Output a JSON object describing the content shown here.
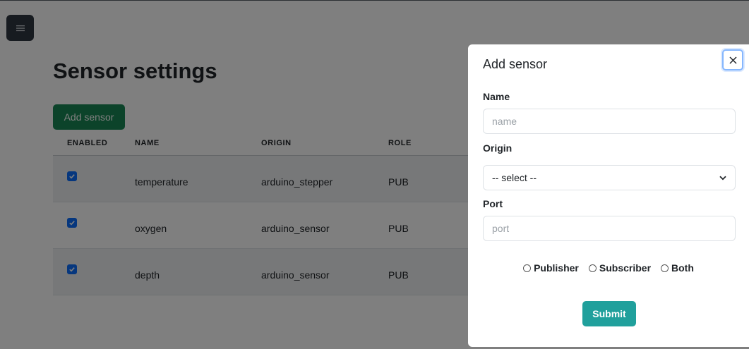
{
  "page": {
    "title": "Sensor settings",
    "add_button_label": "Add sensor"
  },
  "table": {
    "headers": [
      "ENABLED",
      "NAME",
      "ORIGIN",
      "ROLE"
    ],
    "rows": [
      {
        "enabled": true,
        "name": "temperature",
        "origin": "arduino_stepper",
        "role": "PUB"
      },
      {
        "enabled": true,
        "name": "oxygen",
        "origin": "arduino_sensor",
        "role": "PUB"
      },
      {
        "enabled": true,
        "name": "depth",
        "origin": "arduino_sensor",
        "role": "PUB"
      }
    ]
  },
  "offcanvas": {
    "title": "Add sensor",
    "close_label": "×",
    "name_label": "Name",
    "name_placeholder": "name",
    "origin_label": "Origin",
    "origin_selected": "-- select --",
    "port_label": "Port",
    "port_placeholder": "port",
    "roles": [
      "Publisher",
      "Subscriber",
      "Both"
    ],
    "submit_label": "Submit"
  },
  "icons": {
    "menu": "hamburger-menu-icon",
    "checkbox": "check-icon",
    "chevron": "chevron-down-icon",
    "close": "close-icon"
  },
  "colors": {
    "primary_green": "#198754",
    "submit_teal": "#20a09c",
    "checkbox_blue": "#0d6efd",
    "menu_bg": "#2f3640",
    "backdrop": "rgba(0,0,0,0.5)"
  }
}
